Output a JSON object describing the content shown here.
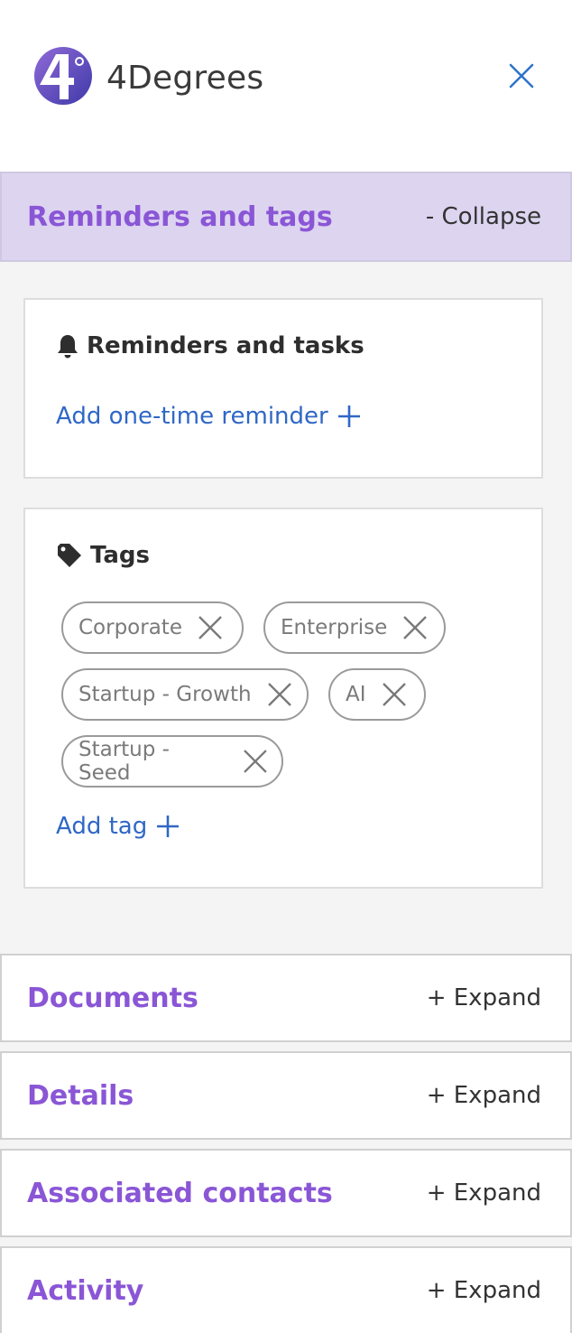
{
  "app": {
    "brand": "4Degrees"
  },
  "icons": {
    "logo": "4degrees-logo",
    "close": "close-icon",
    "bell": "bell-icon",
    "tag": "tag-icon",
    "plus": "plus-icon",
    "chip_remove": "x-icon"
  },
  "colors": {
    "accent": "#8a56d6",
    "link": "#2f67c6",
    "active_header_bg": "#ddd4f0"
  },
  "reminders_section": {
    "title": "Reminders and tags",
    "toggle": "- Collapse",
    "reminders_card": {
      "title": "Reminders and tasks",
      "add_label": "Add one-time reminder"
    },
    "tags_card": {
      "title": "Tags",
      "tags": [
        "Corporate",
        "Enterprise",
        "Startup - Growth",
        "AI",
        "Startup - Seed"
      ],
      "add_label": "Add tag"
    }
  },
  "sections": [
    {
      "title": "Documents",
      "toggle": "+ Expand"
    },
    {
      "title": "Details",
      "toggle": "+ Expand"
    },
    {
      "title": "Associated contacts",
      "toggle": "+ Expand"
    },
    {
      "title": "Activity",
      "toggle": "+ Expand"
    }
  ]
}
